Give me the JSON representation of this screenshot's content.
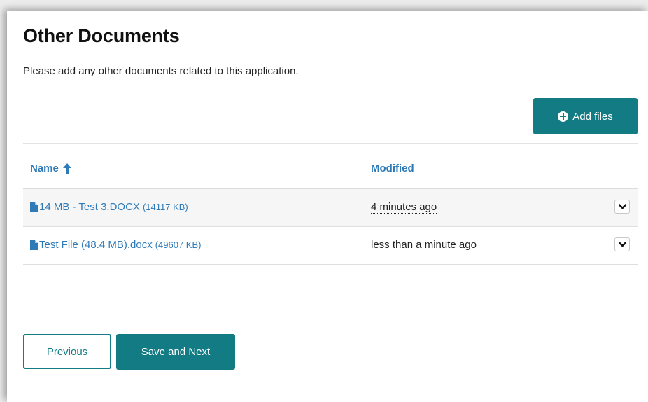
{
  "page": {
    "title": "Other Documents",
    "description": "Please add any other documents related to this application."
  },
  "toolbar": {
    "add_files_label": "Add files",
    "add_icon": "plus-circle-icon"
  },
  "table": {
    "columns": [
      {
        "label": "Name",
        "sort": "ascending",
        "sort_icon": "arrow-up-icon"
      },
      {
        "label": "Modified"
      }
    ],
    "rows": [
      {
        "name": "14 MB - Test 3.DOCX",
        "size": "(14117 KB)",
        "modified": "4 minutes ago",
        "icon": "file-icon",
        "action_icon": "chevron-down-icon"
      },
      {
        "name": "Test File (48.4 MB).docx",
        "size": "(49607 KB)",
        "modified": "less than a minute ago",
        "icon": "file-icon",
        "action_icon": "chevron-down-icon"
      }
    ]
  },
  "footer": {
    "previous_label": "Previous",
    "next_label": "Save and Next"
  },
  "colors": {
    "accent": "#127b84",
    "link": "#2f7bb8",
    "row_alt": "#f6f6f6"
  }
}
